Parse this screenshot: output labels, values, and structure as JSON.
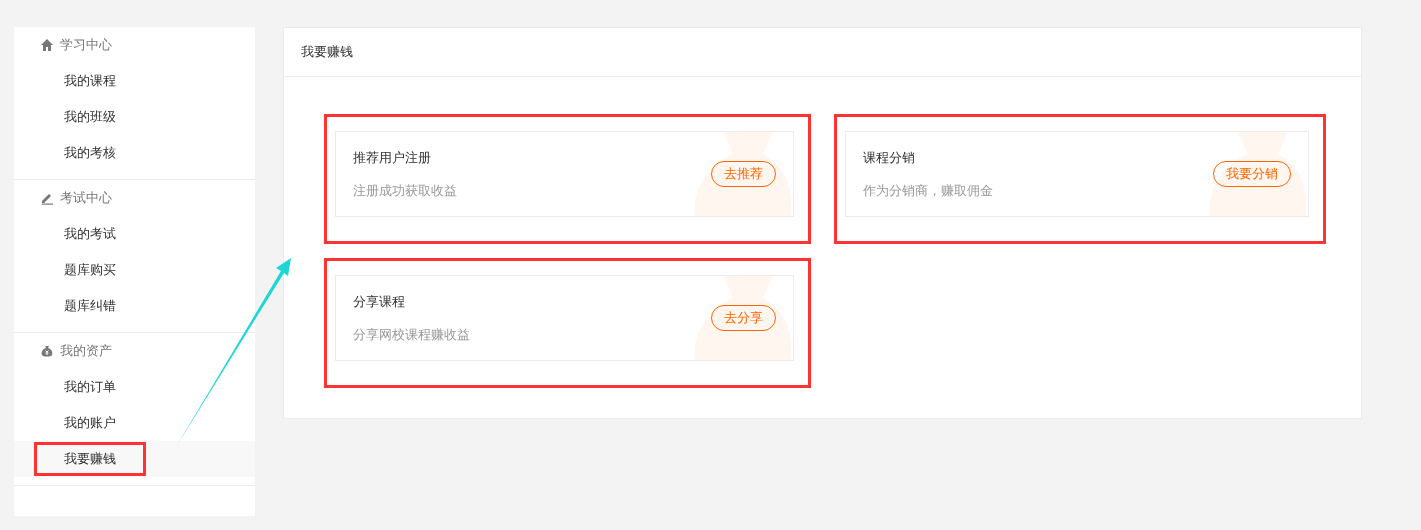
{
  "sidebar": {
    "groups": [
      {
        "title": "学习中心",
        "items": [
          {
            "label": "我的课程",
            "selected": false,
            "highlighted": false
          },
          {
            "label": "我的班级",
            "selected": false,
            "highlighted": false
          },
          {
            "label": "我的考核",
            "selected": false,
            "highlighted": false
          }
        ]
      },
      {
        "title": "考试中心",
        "items": [
          {
            "label": "我的考试",
            "selected": false,
            "highlighted": false
          },
          {
            "label": "题库购买",
            "selected": false,
            "highlighted": false
          },
          {
            "label": "题库纠错",
            "selected": false,
            "highlighted": false
          }
        ]
      },
      {
        "title": "我的资产",
        "items": [
          {
            "label": "我的订单",
            "selected": false,
            "highlighted": false
          },
          {
            "label": "我的账户",
            "selected": false,
            "highlighted": false
          },
          {
            "label": "我要赚钱",
            "selected": true,
            "highlighted": true
          }
        ]
      }
    ]
  },
  "panel": {
    "title": "我要赚钱",
    "cards": [
      {
        "title": "推荐用户注册",
        "subtitle": "注册成功获取收益",
        "button": "去推荐",
        "highlighted": true
      },
      {
        "title": "课程分销",
        "subtitle": "作为分销商，赚取佣金",
        "button": "我要分销",
        "highlighted": true
      },
      {
        "title": "分享课程",
        "subtitle": "分享网校课程赚收益",
        "button": "去分享",
        "highlighted": true
      }
    ]
  }
}
